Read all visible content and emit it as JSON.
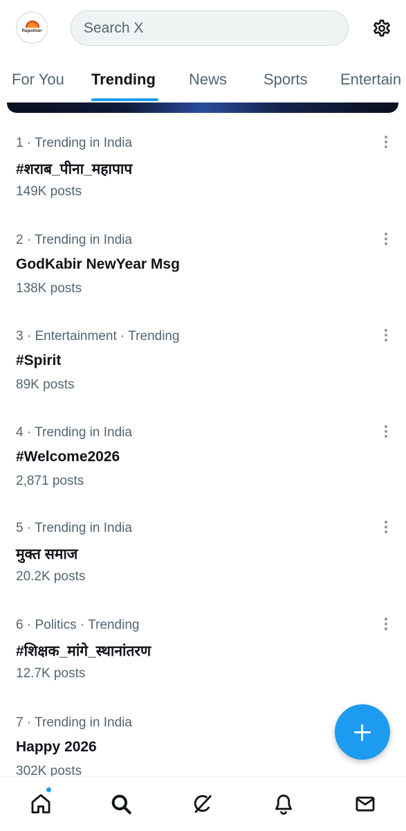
{
  "header": {
    "avatar_text": "Rajasthan",
    "search_placeholder": "Search X"
  },
  "tabs": [
    {
      "label": "For You",
      "active": false
    },
    {
      "label": "Trending",
      "active": true
    },
    {
      "label": "News",
      "active": false
    },
    {
      "label": "Sports",
      "active": false
    },
    {
      "label": "Entertain",
      "active": false
    }
  ],
  "trends": [
    {
      "meta": "1 · Trending in India",
      "title": "#शराब_पीना_महापाप",
      "count": "149K posts"
    },
    {
      "meta": "2 · Trending in India",
      "title": "GodKabir NewYear Msg",
      "count": "138K posts"
    },
    {
      "meta": "3 · Entertainment · Trending",
      "title": "#Spirit",
      "count": "89K posts"
    },
    {
      "meta": "4 · Trending in India",
      "title": "#Welcome2026",
      "count": "2,871 posts"
    },
    {
      "meta": "5 · Trending in India",
      "title": "मुक्त समाज",
      "count": "20.2K posts"
    },
    {
      "meta": "6 · Politics · Trending",
      "title": "#शिक्षक_मांगे_स्थानांतरण",
      "count": "12.7K posts"
    },
    {
      "meta": "7 · Trending in India",
      "title": "Happy 2026",
      "count": "302K posts"
    }
  ],
  "bottom_nav": [
    {
      "icon": "home-icon",
      "has_notification": true
    },
    {
      "icon": "search-icon",
      "active": true
    },
    {
      "icon": "grok-icon"
    },
    {
      "icon": "bell-icon"
    },
    {
      "icon": "mail-icon"
    }
  ],
  "colors": {
    "accent": "#1d9bf0",
    "text_primary": "#0f1419",
    "text_secondary": "#536471"
  }
}
